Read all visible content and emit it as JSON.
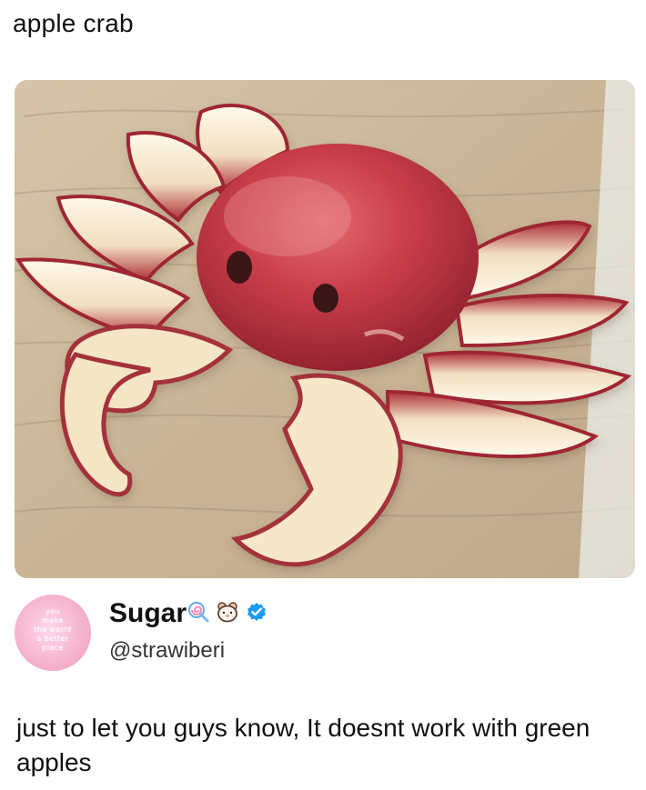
{
  "post": {
    "caption": "apple crab",
    "image_alt": "apple crab"
  },
  "tweet": {
    "avatar_text": [
      "you",
      "make",
      "the world",
      "a better",
      "place"
    ],
    "display_name": "Sugar",
    "handle": "@strawiberi",
    "text": "just to let you guys know, It doesnt work with green apples",
    "badges": [
      "lollipop-icon",
      "hamster-icon",
      "verified-icon"
    ]
  },
  "colors": {
    "verified": "#1d9bf0",
    "avatar_pink": "#f4a7c8",
    "apple_red": "#b62f3d"
  }
}
